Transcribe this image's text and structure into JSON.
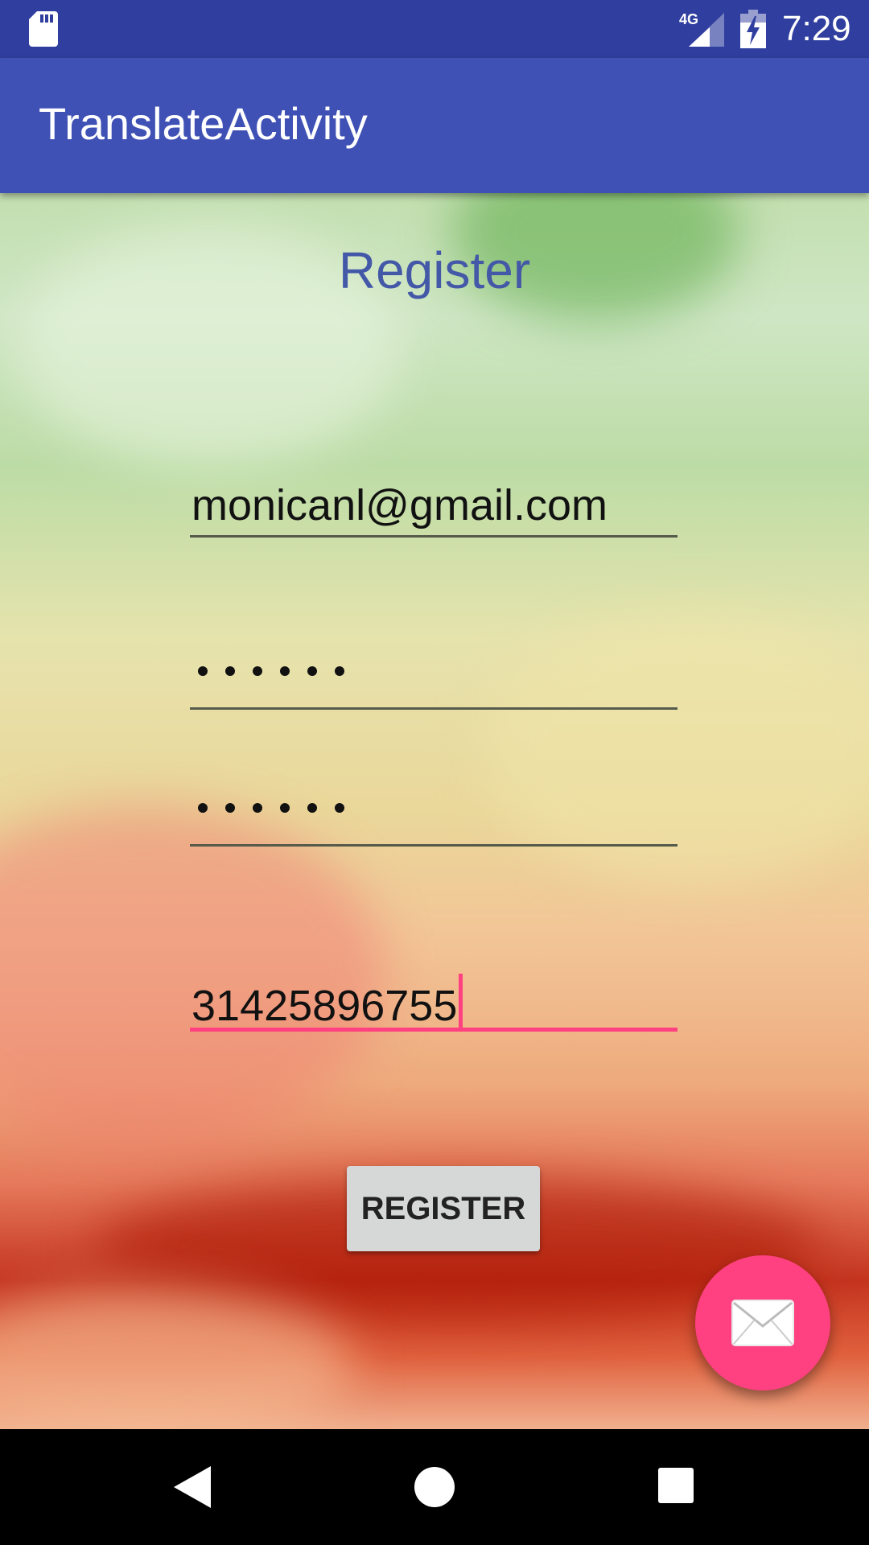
{
  "status_bar": {
    "time": "7:29",
    "network_label": "4G",
    "icons": [
      "sd-card-icon",
      "signal-4g-icon",
      "battery-charging-icon"
    ]
  },
  "app_bar": {
    "title": "TranslateActivity"
  },
  "form": {
    "heading": "Register",
    "email_value": "monicanl@gmail.com",
    "password_dot_count": 6,
    "confirm_password_dot_count": 6,
    "phone_value": "31425896755",
    "register_button_label": "REGISTER"
  },
  "fab": {
    "icon": "mail-icon"
  },
  "nav_bar": {
    "icons": [
      "back-icon",
      "home-icon",
      "recents-icon"
    ]
  },
  "colors": {
    "status_bar": "#303f9f",
    "app_bar": "#3f51b5",
    "accent": "#ff4081",
    "heading_text": "#4458a8",
    "button": "#d6d7d7"
  }
}
